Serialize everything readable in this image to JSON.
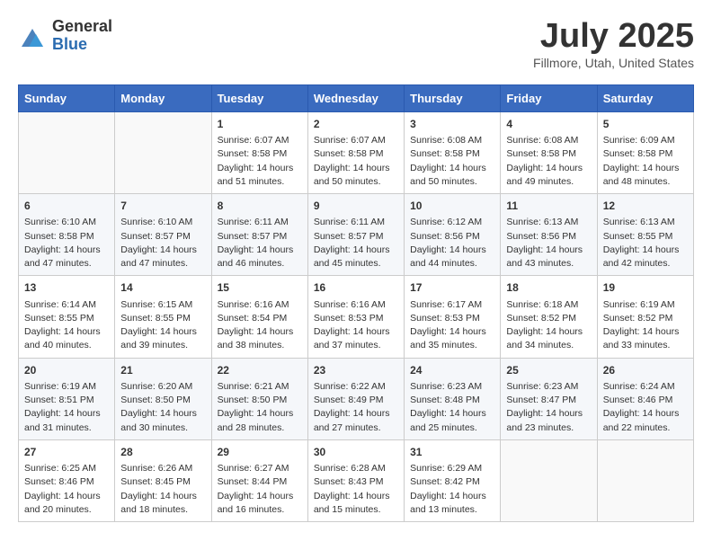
{
  "header": {
    "logo_general": "General",
    "logo_blue": "Blue",
    "month_title": "July 2025",
    "location": "Fillmore, Utah, United States"
  },
  "weekdays": [
    "Sunday",
    "Monday",
    "Tuesday",
    "Wednesday",
    "Thursday",
    "Friday",
    "Saturday"
  ],
  "weeks": [
    [
      {
        "day": "",
        "sunrise": "",
        "sunset": "",
        "daylight": ""
      },
      {
        "day": "",
        "sunrise": "",
        "sunset": "",
        "daylight": ""
      },
      {
        "day": "1",
        "sunrise": "Sunrise: 6:07 AM",
        "sunset": "Sunset: 8:58 PM",
        "daylight": "Daylight: 14 hours and 51 minutes."
      },
      {
        "day": "2",
        "sunrise": "Sunrise: 6:07 AM",
        "sunset": "Sunset: 8:58 PM",
        "daylight": "Daylight: 14 hours and 50 minutes."
      },
      {
        "day": "3",
        "sunrise": "Sunrise: 6:08 AM",
        "sunset": "Sunset: 8:58 PM",
        "daylight": "Daylight: 14 hours and 50 minutes."
      },
      {
        "day": "4",
        "sunrise": "Sunrise: 6:08 AM",
        "sunset": "Sunset: 8:58 PM",
        "daylight": "Daylight: 14 hours and 49 minutes."
      },
      {
        "day": "5",
        "sunrise": "Sunrise: 6:09 AM",
        "sunset": "Sunset: 8:58 PM",
        "daylight": "Daylight: 14 hours and 48 minutes."
      }
    ],
    [
      {
        "day": "6",
        "sunrise": "Sunrise: 6:10 AM",
        "sunset": "Sunset: 8:58 PM",
        "daylight": "Daylight: 14 hours and 47 minutes."
      },
      {
        "day": "7",
        "sunrise": "Sunrise: 6:10 AM",
        "sunset": "Sunset: 8:57 PM",
        "daylight": "Daylight: 14 hours and 47 minutes."
      },
      {
        "day": "8",
        "sunrise": "Sunrise: 6:11 AM",
        "sunset": "Sunset: 8:57 PM",
        "daylight": "Daylight: 14 hours and 46 minutes."
      },
      {
        "day": "9",
        "sunrise": "Sunrise: 6:11 AM",
        "sunset": "Sunset: 8:57 PM",
        "daylight": "Daylight: 14 hours and 45 minutes."
      },
      {
        "day": "10",
        "sunrise": "Sunrise: 6:12 AM",
        "sunset": "Sunset: 8:56 PM",
        "daylight": "Daylight: 14 hours and 44 minutes."
      },
      {
        "day": "11",
        "sunrise": "Sunrise: 6:13 AM",
        "sunset": "Sunset: 8:56 PM",
        "daylight": "Daylight: 14 hours and 43 minutes."
      },
      {
        "day": "12",
        "sunrise": "Sunrise: 6:13 AM",
        "sunset": "Sunset: 8:55 PM",
        "daylight": "Daylight: 14 hours and 42 minutes."
      }
    ],
    [
      {
        "day": "13",
        "sunrise": "Sunrise: 6:14 AM",
        "sunset": "Sunset: 8:55 PM",
        "daylight": "Daylight: 14 hours and 40 minutes."
      },
      {
        "day": "14",
        "sunrise": "Sunrise: 6:15 AM",
        "sunset": "Sunset: 8:55 PM",
        "daylight": "Daylight: 14 hours and 39 minutes."
      },
      {
        "day": "15",
        "sunrise": "Sunrise: 6:16 AM",
        "sunset": "Sunset: 8:54 PM",
        "daylight": "Daylight: 14 hours and 38 minutes."
      },
      {
        "day": "16",
        "sunrise": "Sunrise: 6:16 AM",
        "sunset": "Sunset: 8:53 PM",
        "daylight": "Daylight: 14 hours and 37 minutes."
      },
      {
        "day": "17",
        "sunrise": "Sunrise: 6:17 AM",
        "sunset": "Sunset: 8:53 PM",
        "daylight": "Daylight: 14 hours and 35 minutes."
      },
      {
        "day": "18",
        "sunrise": "Sunrise: 6:18 AM",
        "sunset": "Sunset: 8:52 PM",
        "daylight": "Daylight: 14 hours and 34 minutes."
      },
      {
        "day": "19",
        "sunrise": "Sunrise: 6:19 AM",
        "sunset": "Sunset: 8:52 PM",
        "daylight": "Daylight: 14 hours and 33 minutes."
      }
    ],
    [
      {
        "day": "20",
        "sunrise": "Sunrise: 6:19 AM",
        "sunset": "Sunset: 8:51 PM",
        "daylight": "Daylight: 14 hours and 31 minutes."
      },
      {
        "day": "21",
        "sunrise": "Sunrise: 6:20 AM",
        "sunset": "Sunset: 8:50 PM",
        "daylight": "Daylight: 14 hours and 30 minutes."
      },
      {
        "day": "22",
        "sunrise": "Sunrise: 6:21 AM",
        "sunset": "Sunset: 8:50 PM",
        "daylight": "Daylight: 14 hours and 28 minutes."
      },
      {
        "day": "23",
        "sunrise": "Sunrise: 6:22 AM",
        "sunset": "Sunset: 8:49 PM",
        "daylight": "Daylight: 14 hours and 27 minutes."
      },
      {
        "day": "24",
        "sunrise": "Sunrise: 6:23 AM",
        "sunset": "Sunset: 8:48 PM",
        "daylight": "Daylight: 14 hours and 25 minutes."
      },
      {
        "day": "25",
        "sunrise": "Sunrise: 6:23 AM",
        "sunset": "Sunset: 8:47 PM",
        "daylight": "Daylight: 14 hours and 23 minutes."
      },
      {
        "day": "26",
        "sunrise": "Sunrise: 6:24 AM",
        "sunset": "Sunset: 8:46 PM",
        "daylight": "Daylight: 14 hours and 22 minutes."
      }
    ],
    [
      {
        "day": "27",
        "sunrise": "Sunrise: 6:25 AM",
        "sunset": "Sunset: 8:46 PM",
        "daylight": "Daylight: 14 hours and 20 minutes."
      },
      {
        "day": "28",
        "sunrise": "Sunrise: 6:26 AM",
        "sunset": "Sunset: 8:45 PM",
        "daylight": "Daylight: 14 hours and 18 minutes."
      },
      {
        "day": "29",
        "sunrise": "Sunrise: 6:27 AM",
        "sunset": "Sunset: 8:44 PM",
        "daylight": "Daylight: 14 hours and 16 minutes."
      },
      {
        "day": "30",
        "sunrise": "Sunrise: 6:28 AM",
        "sunset": "Sunset: 8:43 PM",
        "daylight": "Daylight: 14 hours and 15 minutes."
      },
      {
        "day": "31",
        "sunrise": "Sunrise: 6:29 AM",
        "sunset": "Sunset: 8:42 PM",
        "daylight": "Daylight: 14 hours and 13 minutes."
      },
      {
        "day": "",
        "sunrise": "",
        "sunset": "",
        "daylight": ""
      },
      {
        "day": "",
        "sunrise": "",
        "sunset": "",
        "daylight": ""
      }
    ]
  ]
}
